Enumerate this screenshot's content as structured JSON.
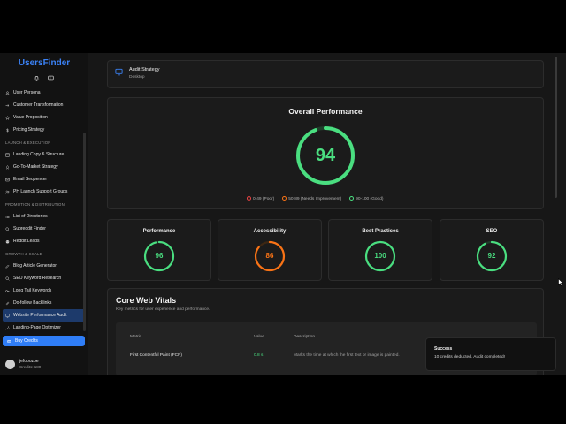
{
  "app": {
    "name": "UsersFinder"
  },
  "sidebar": {
    "items": [
      {
        "type": "item",
        "label": "User Persona",
        "icon": "user-icon"
      },
      {
        "type": "item",
        "label": "Customer Transformation",
        "icon": "arrow-right-icon"
      },
      {
        "type": "item",
        "label": "Value Proposition",
        "icon": "star-icon"
      },
      {
        "type": "item",
        "label": "Pricing Strategy",
        "icon": "dollar-icon"
      },
      {
        "type": "section",
        "label": "LAUNCH & EXECUTION"
      },
      {
        "type": "item",
        "label": "Landing Copy & Structure",
        "icon": "layout-icon"
      },
      {
        "type": "item",
        "label": "Go-To-Market Strategy",
        "icon": "rocket-icon"
      },
      {
        "type": "item",
        "label": "Email Sequencer",
        "icon": "mail-icon"
      },
      {
        "type": "item",
        "label": "PH Launch Support Groups",
        "icon": "users-icon"
      },
      {
        "type": "section",
        "label": "PROMOTION & DISTRIBUTION"
      },
      {
        "type": "item",
        "label": "List of Directories",
        "icon": "list-icon"
      },
      {
        "type": "item",
        "label": "Subreddit Finder",
        "icon": "search-icon"
      },
      {
        "type": "item",
        "label": "Reddit Leads",
        "icon": "reddit-icon"
      },
      {
        "type": "section",
        "label": "GROWTH & SCALE"
      },
      {
        "type": "item",
        "label": "Blog Article Generator",
        "icon": "pen-icon"
      },
      {
        "type": "item",
        "label": "SEO Keyword Research",
        "icon": "search-icon"
      },
      {
        "type": "item",
        "label": "Long Tail Keywords",
        "icon": "key-icon"
      },
      {
        "type": "item",
        "label": "Do-follow Backlinks",
        "icon": "link-icon"
      },
      {
        "type": "item",
        "label": "Website Performance Audit",
        "icon": "monitor-icon",
        "active": true
      },
      {
        "type": "item",
        "label": "Landing-Page Optimizer",
        "icon": "wand-icon"
      }
    ],
    "buy_label": "Buy Credits",
    "user": {
      "name": "jefobozoe",
      "credits": "Credits: 180"
    }
  },
  "strategy": {
    "title": "Audit Strategy",
    "value": "Desktop"
  },
  "overall": {
    "title": "Overall Performance",
    "score": 94,
    "score_text": "94",
    "legend": [
      {
        "label": "0-49 (Poor)",
        "color": "#ef4444"
      },
      {
        "label": "50-89 (Needs Improvement)",
        "color": "#f97316"
      },
      {
        "label": "90-100 (Good)",
        "color": "#4ade80"
      }
    ]
  },
  "scores": [
    {
      "title": "Performance",
      "value": 96,
      "text": "96",
      "color": "#4ade80"
    },
    {
      "title": "Accessibility",
      "value": 86,
      "text": "86",
      "color": "#f97316"
    },
    {
      "title": "Best Practices",
      "value": 100,
      "text": "100",
      "color": "#4ade80"
    },
    {
      "title": "SEO",
      "value": 92,
      "text": "92",
      "color": "#4ade80"
    }
  ],
  "cwv": {
    "title": "Core Web Vitals",
    "subtitle": "Key metrics for user experience and performance.",
    "headers": {
      "metric": "Metric",
      "value": "Value",
      "description": "Description"
    },
    "rows": [
      {
        "metric": "First Contentful Paint (FCP)",
        "value": "0.8 s",
        "description": "Marks the time at which the first text or image is painted."
      }
    ]
  },
  "toast": {
    "title": "Success",
    "message": "10 credits deducted. Audit completed!"
  },
  "colors": {
    "accent": "#2f7df6",
    "good": "#4ade80",
    "warn": "#f97316",
    "bad": "#ef4444"
  }
}
